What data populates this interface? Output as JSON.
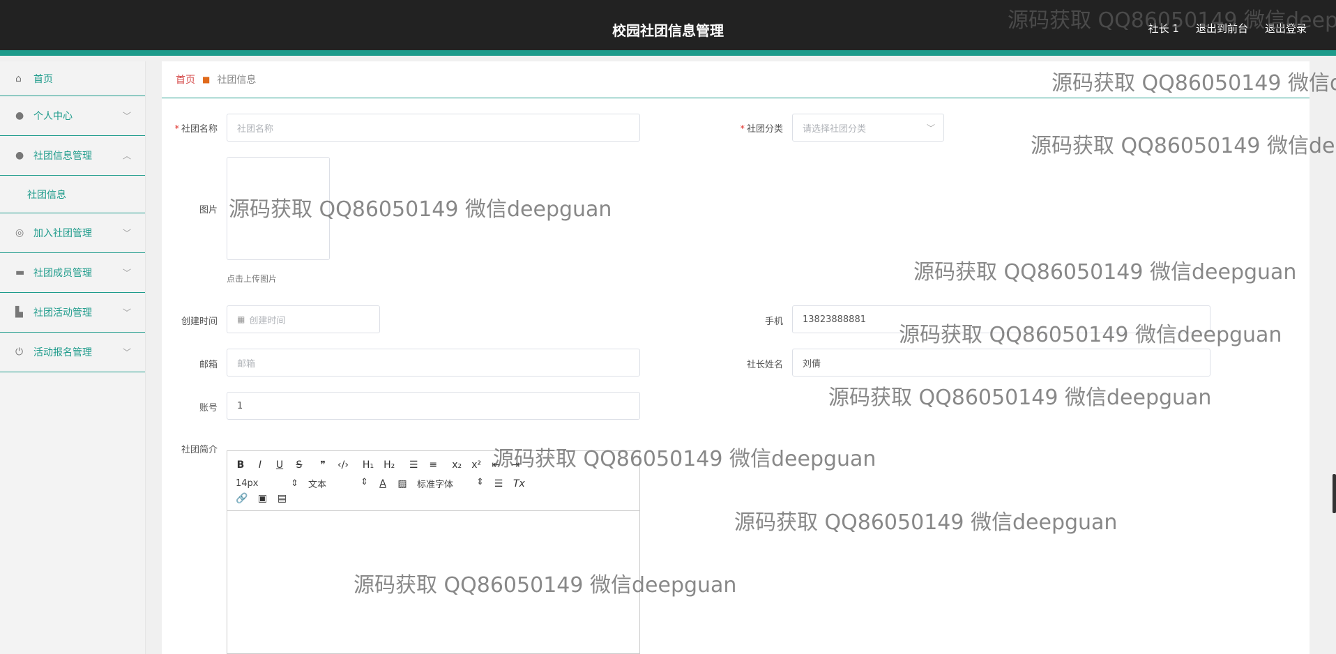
{
  "header": {
    "title": "校园社团信息管理",
    "user": "社长 1",
    "to_front": "退出到前台",
    "logout": "退出登录"
  },
  "sidebar": {
    "items": [
      {
        "label": "首页",
        "icon": "home-icon"
      },
      {
        "label": "个人中心",
        "icon": "user-icon"
      },
      {
        "label": "社团信息管理",
        "icon": "user-icon"
      },
      {
        "label": "加入社团管理",
        "icon": "target-icon"
      },
      {
        "label": "社团成员管理",
        "icon": "briefcase-icon"
      },
      {
        "label": "社团活动管理",
        "icon": "building-icon"
      },
      {
        "label": "活动报名管理",
        "icon": "power-icon"
      }
    ],
    "sub": "社团信息"
  },
  "breadcrumb": {
    "home": "首页",
    "current": "社团信息"
  },
  "form": {
    "name_label": "社团名称",
    "name_placeholder": "社团名称",
    "category_label": "社团分类",
    "category_placeholder": "请选择社团分类",
    "image_label": "图片",
    "upload_hint": "点击上传图片",
    "created_label": "创建时间",
    "created_placeholder": "创建时间",
    "phone_label": "手机",
    "phone_value": "13823888881",
    "email_label": "邮箱",
    "email_placeholder": "邮箱",
    "leader_label": "社长姓名",
    "leader_value": "刘倩",
    "account_label": "账号",
    "account_value": "1",
    "intro_label": "社团简介"
  },
  "editor": {
    "font_size": "14px",
    "format": "文本",
    "font_family": "标准字体"
  },
  "watermark": "源码获取 QQ86050149 微信deepguan",
  "colors": {
    "accent": "#1d9b8b",
    "header_bg": "#222222",
    "required": "#e0302a"
  }
}
